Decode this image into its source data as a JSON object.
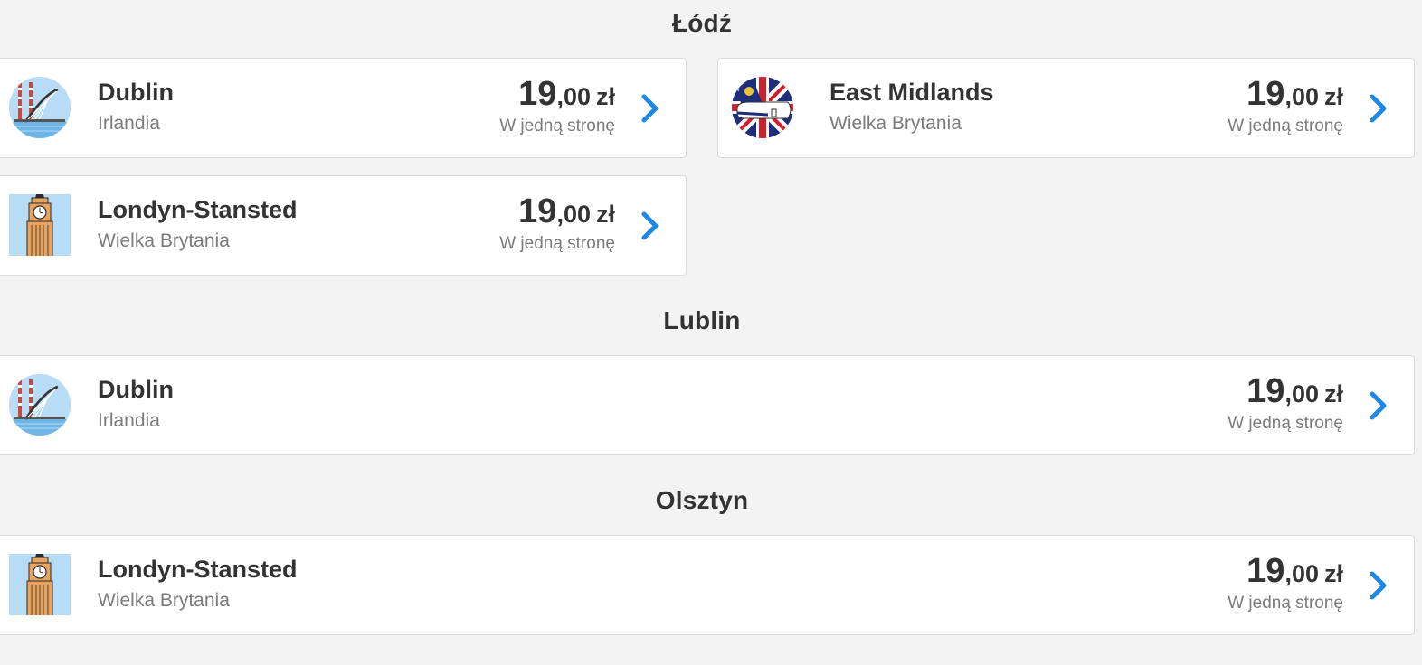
{
  "sections": [
    {
      "title": "Łódź",
      "cards": [
        {
          "city": "Dublin",
          "country": "Irlandia",
          "price_int": "19",
          "price_dec": ",00",
          "currency": "zł",
          "trip_type": "W jedną stronę",
          "icon": "dublin-bridge-icon"
        },
        {
          "city": "East Midlands",
          "country": "Wielka Brytania",
          "price_int": "19",
          "price_dec": ",00",
          "currency": "zł",
          "trip_type": "W jedną stronę",
          "icon": "ryanair-plane-union-jack-icon"
        },
        {
          "city": "Londyn-Stansted",
          "country": "Wielka Brytania",
          "price_int": "19",
          "price_dec": ",00",
          "currency": "zł",
          "trip_type": "W jedną stronę",
          "icon": "big-ben-icon"
        }
      ]
    },
    {
      "title": "Lublin",
      "cards": [
        {
          "city": "Dublin",
          "country": "Irlandia",
          "price_int": "19",
          "price_dec": ",00",
          "currency": "zł",
          "trip_type": "W jedną stronę",
          "icon": "dublin-bridge-icon"
        }
      ]
    },
    {
      "title": "Olsztyn",
      "cards": [
        {
          "city": "Londyn-Stansted",
          "country": "Wielka Brytania",
          "price_int": "19",
          "price_dec": ",00",
          "currency": "zł",
          "trip_type": "W jedną stronę",
          "icon": "big-ben-icon"
        }
      ]
    }
  ],
  "colors": {
    "chevron": "#1e88e5",
    "background": "#f3f3f3",
    "card": "#ffffff"
  }
}
